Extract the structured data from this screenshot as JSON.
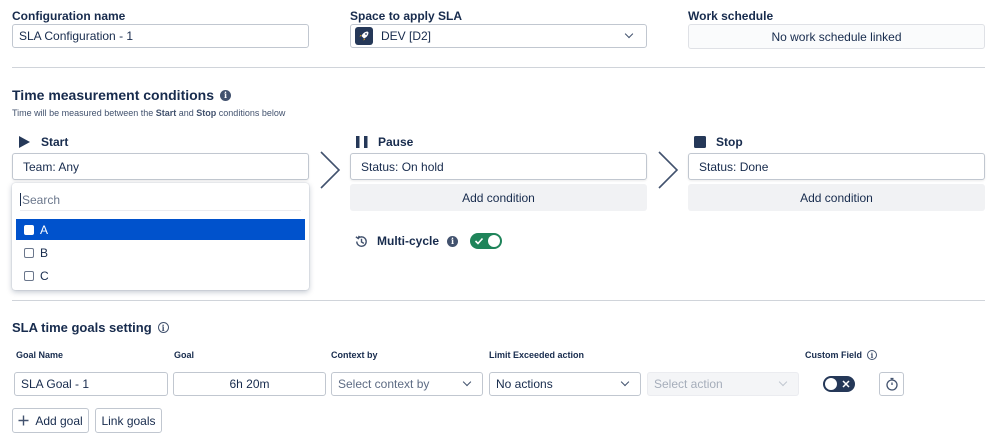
{
  "config": {
    "name_label": "Configuration name",
    "name_value": "SLA Configuration - 1",
    "space_label": "Space to apply SLA",
    "space_value": "DEV [D2]",
    "schedule_label": "Work schedule",
    "schedule_value": "No work schedule linked"
  },
  "time_conditions": {
    "title": "Time measurement conditions",
    "subtitle_pre": "Time will be measured between the ",
    "subtitle_start": "Start",
    "subtitle_mid": " and ",
    "subtitle_stop": "Stop",
    "subtitle_post": " conditions below",
    "start": {
      "label": "Start",
      "condition": "Team: Any"
    },
    "pause": {
      "label": "Pause",
      "condition": "Status: On hold",
      "add_label": "Add condition"
    },
    "stop": {
      "label": "Stop",
      "condition": "Status: Done",
      "add_label": "Add condition"
    },
    "multi_cycle_label": "Multi-cycle",
    "multi_cycle_on": true
  },
  "dropdown": {
    "search_placeholder": "Search",
    "options": [
      {
        "label": "A",
        "selected": true
      },
      {
        "label": "B",
        "selected": false
      },
      {
        "label": "C",
        "selected": false
      }
    ]
  },
  "goals": {
    "title": "SLA time goals setting",
    "headers": {
      "goal_name": "Goal Name",
      "goal": "Goal",
      "context_by": "Context by",
      "limit_action": "Limit Exceeded action",
      "custom_field": "Custom Field"
    },
    "row": {
      "goal_name": "SLA Goal - 1",
      "goal": "6h 20m",
      "context_placeholder": "Select context by",
      "limit_action": "No actions",
      "action_placeholder": "Select action"
    },
    "add_goal_label": "Add goal",
    "link_goals_label": "Link goals"
  },
  "colors": {
    "accent": "#0052cc",
    "toggle_on": "#1f845a",
    "toggle_dark": "#253858"
  }
}
